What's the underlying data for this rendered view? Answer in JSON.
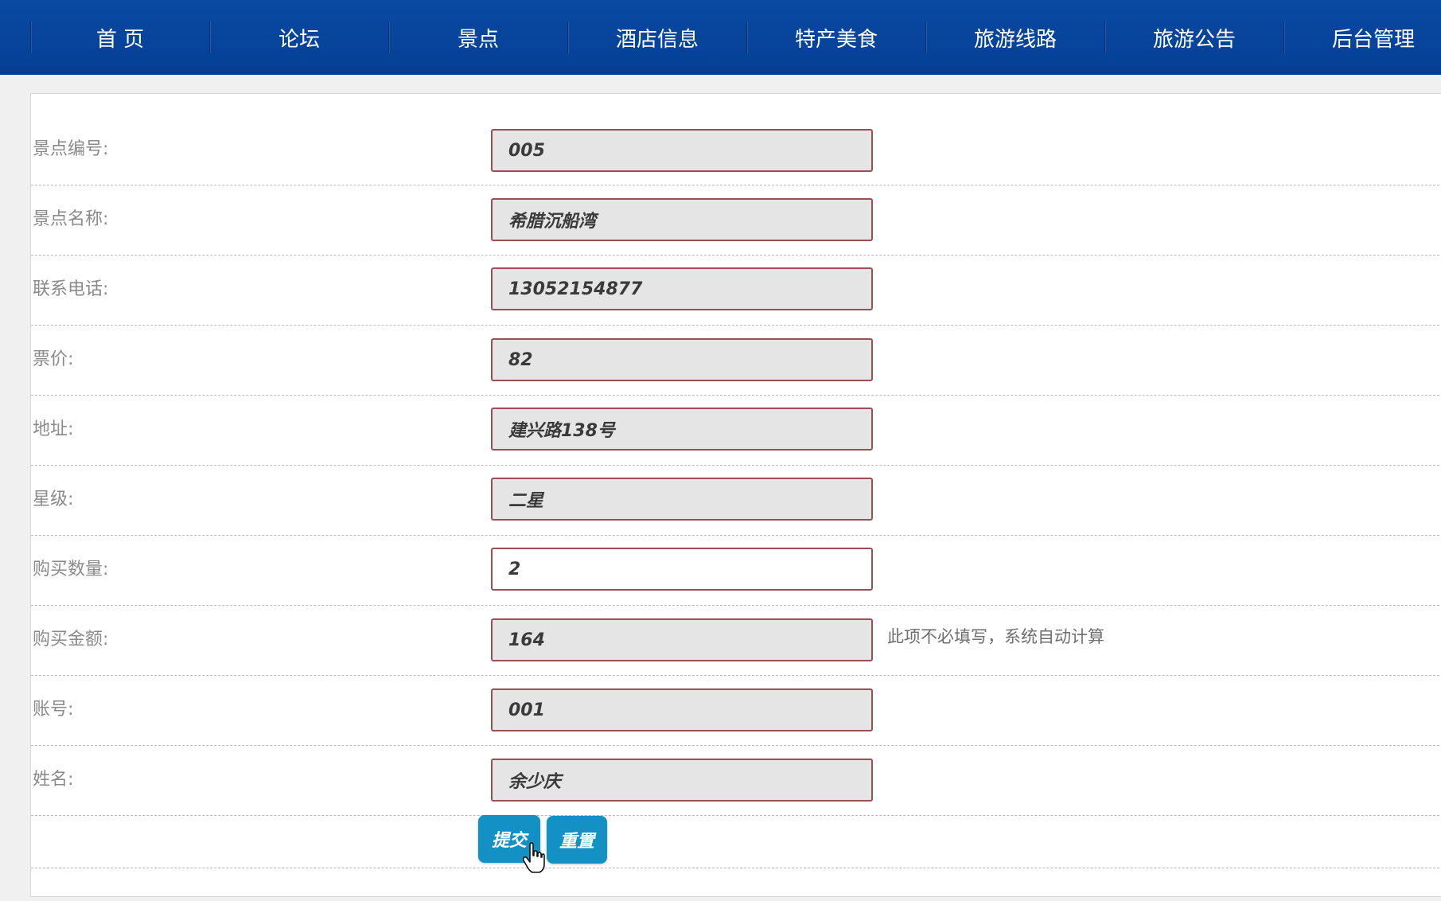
{
  "nav": {
    "items": [
      "首 页",
      "论坛",
      "景点",
      "酒店信息",
      "特产美食",
      "旅游线路",
      "旅游公告",
      "后台管理"
    ]
  },
  "form": {
    "fields": [
      {
        "label": "景点编号:",
        "value": "005"
      },
      {
        "label": "景点名称:",
        "value": "希腊沉船湾"
      },
      {
        "label": "联系电话:",
        "value": "13052154877"
      },
      {
        "label": "票价:",
        "value": "82"
      },
      {
        "label": "地址:",
        "value": "建兴路138号"
      },
      {
        "label": "星级:",
        "value": "二星"
      },
      {
        "label": "购买数量:",
        "value": "2"
      },
      {
        "label": "购买金额:",
        "value": "164",
        "hint": "此项不必填写，系统自动计算"
      },
      {
        "label": "账号:",
        "value": "001"
      },
      {
        "label": "姓名:",
        "value": "余少庆"
      }
    ],
    "submit_label": "提交",
    "reset_label": "重置"
  },
  "colors": {
    "nav_bg": "#0a4aa3",
    "button_bg": "#1391c4",
    "field_border": "#9c4e56",
    "field_readonly_bg": "#e5e5e5"
  }
}
